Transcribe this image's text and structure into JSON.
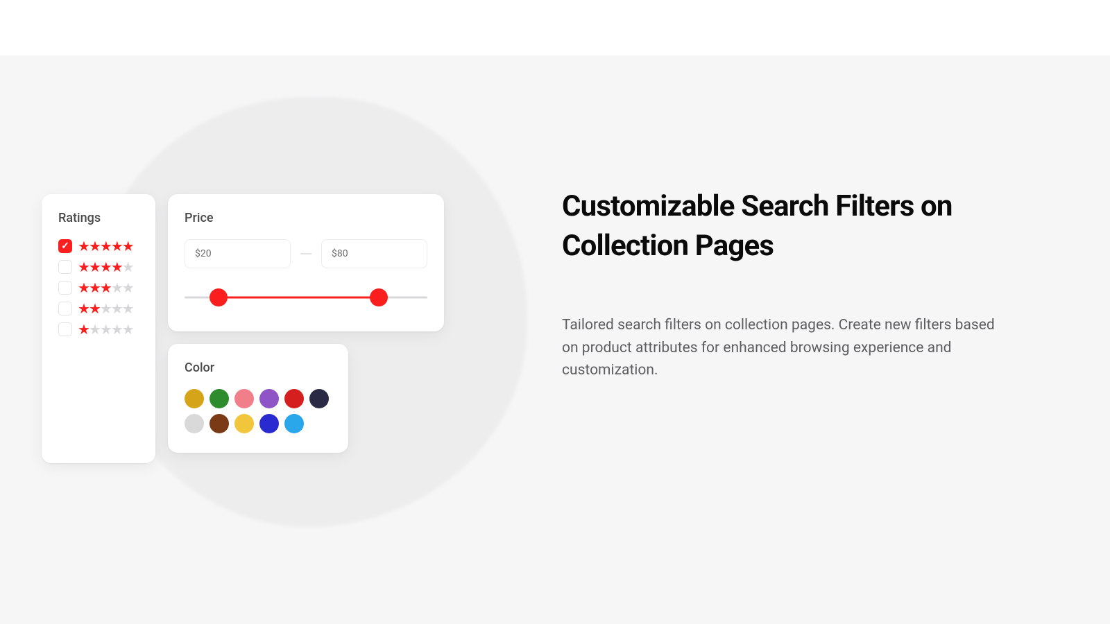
{
  "headline": "Customizable Search Filters on Collection Pages",
  "body": "Tailored search filters on collection pages. Create new filters based on  product attributes for enhanced browsing experience and customization.",
  "ratings": {
    "title": "Ratings",
    "rows": [
      {
        "checked": true,
        "stars": 5
      },
      {
        "checked": false,
        "stars": 4
      },
      {
        "checked": false,
        "stars": 3
      },
      {
        "checked": false,
        "stars": 2
      },
      {
        "checked": false,
        "stars": 1
      }
    ]
  },
  "price": {
    "title": "Price",
    "min": "$20",
    "max": "$80",
    "slider": {
      "min_pct": 14,
      "max_pct": 80
    }
  },
  "color": {
    "title": "Color",
    "swatches": [
      "#d6a419",
      "#2e8c2e",
      "#f07f8a",
      "#8f55c7",
      "#d51f1f",
      "#2a2a44",
      "#d9d9d9",
      "#7a3a15",
      "#f2c63c",
      "#2a2ad1",
      "#2aa6eb"
    ]
  }
}
